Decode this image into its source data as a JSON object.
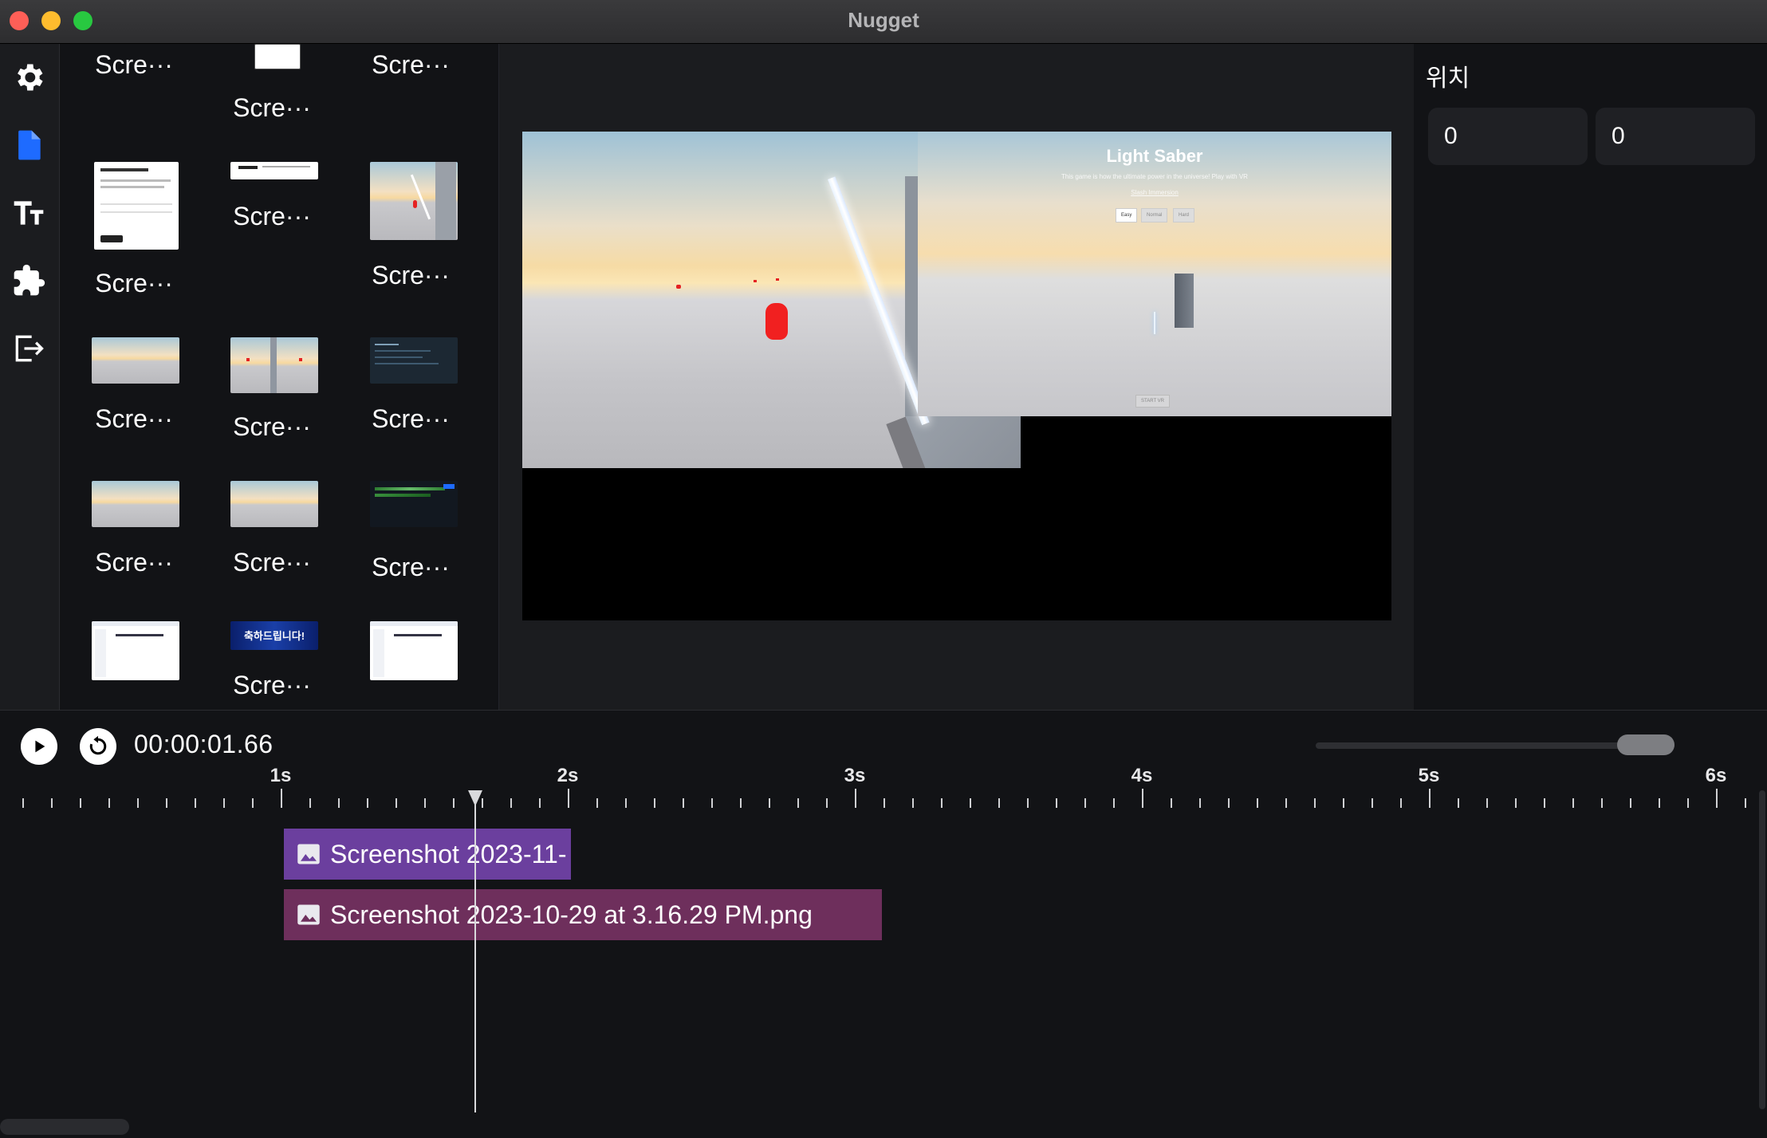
{
  "window": {
    "title": "Nugget"
  },
  "rail": {
    "items": [
      {
        "icon": "gear-icon",
        "active": false
      },
      {
        "icon": "file-icon",
        "active": true
      },
      {
        "icon": "text-icon",
        "active": false
      },
      {
        "icon": "puzzle-icon",
        "active": false
      },
      {
        "icon": "export-icon",
        "active": false
      }
    ]
  },
  "library": {
    "items": [
      {
        "label": "Scre···",
        "thumb": "none"
      },
      {
        "label": "Scre···",
        "thumb": "doc"
      },
      {
        "label": "Scre···",
        "thumb": "none"
      },
      {
        "label": "Scre···",
        "thumb": "doc"
      },
      {
        "label": "Scre···",
        "thumb": "doc"
      },
      {
        "label": "Scre···",
        "thumb": "sky"
      },
      {
        "label": "Scre···",
        "thumb": "sky"
      },
      {
        "label": "Scre···",
        "thumb": "sky"
      },
      {
        "label": "Scre···",
        "thumb": "dark"
      },
      {
        "label": "Scre···",
        "thumb": "sky"
      },
      {
        "label": "Scre···",
        "thumb": "sky"
      },
      {
        "label": "Scre···",
        "thumb": "dark"
      },
      {
        "label": "",
        "thumb": "doc"
      },
      {
        "label": "Scre···",
        "thumb": "banner",
        "banner_text": "축하드립니다!"
      },
      {
        "label": "",
        "thumb": "doc"
      }
    ]
  },
  "preview": {
    "game_title": "Light Saber",
    "game_subtitle": "This game is how the ultimate power in the universe! Play with VR",
    "game_link": "Slash Immersion",
    "buttons": [
      "Easy",
      "Normal",
      "Hard"
    ],
    "bottom_button": "START VR"
  },
  "properties": {
    "title": "위치",
    "x_value": "0",
    "y_value": "0"
  },
  "timeline": {
    "timecode": "00:00:01.66",
    "zoom_level": 0.95,
    "seconds": [
      "1s",
      "2s",
      "3s",
      "4s",
      "5s",
      "6s"
    ],
    "clips": [
      {
        "name": "Screenshot 2023-11-",
        "color": "#6b3f9e"
      },
      {
        "name": "Screenshot 2023-10-29 at 3.16.29 PM.png",
        "color": "#6e2f5c"
      }
    ]
  },
  "colors": {
    "accent": "#1e6bff",
    "clip_purple": "#6b3f9e",
    "clip_magenta": "#6e2f5c"
  }
}
